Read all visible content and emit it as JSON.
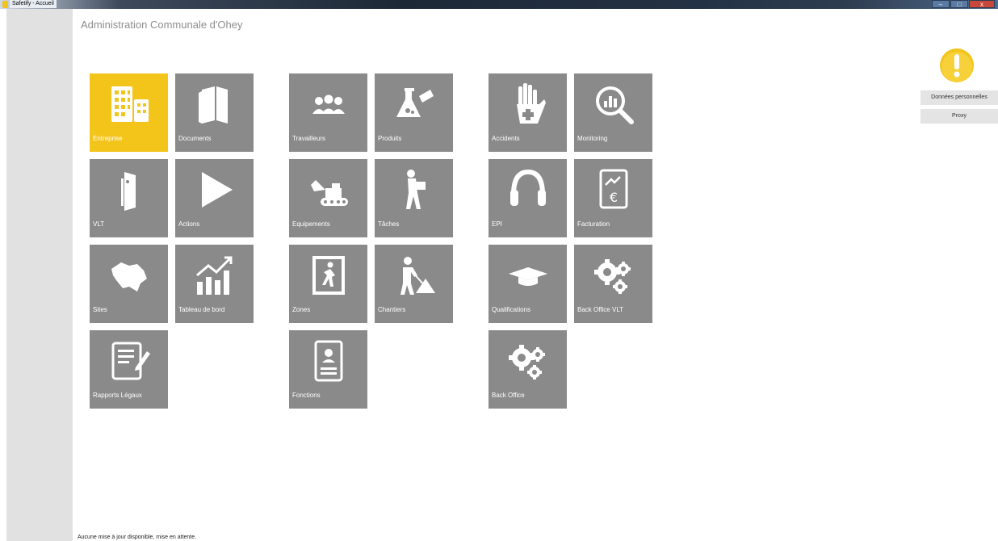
{
  "window": {
    "title": "Safetify - Accueil",
    "controls": {
      "minimize": "–",
      "maximize": "□",
      "close": "x"
    }
  },
  "page_title": "Administration Communale d'Ohey",
  "tiles": [
    {
      "label": "Entreprise",
      "icon": "building-icon",
      "active": true
    },
    {
      "label": "Documents",
      "icon": "books-icon"
    },
    {
      "label": "Travailleurs",
      "icon": "workers-icon"
    },
    {
      "label": "Produits",
      "icon": "chemical-flask-icon"
    },
    {
      "label": "Accidents",
      "icon": "hand-injury-icon"
    },
    {
      "label": "Monitoring",
      "icon": "magnifier-chart-icon"
    },
    {
      "label": "VLT",
      "icon": "door-person-icon"
    },
    {
      "label": "Actions",
      "icon": "play-icon"
    },
    {
      "label": "Equipements",
      "icon": "excavator-icon"
    },
    {
      "label": "Tâches",
      "icon": "worker-carrying-icon"
    },
    {
      "label": "EPI",
      "icon": "ear-protection-icon"
    },
    {
      "label": "Facturation",
      "icon": "invoice-euro-icon"
    },
    {
      "label": "Sites",
      "icon": "belgium-map-icon"
    },
    {
      "label": "Tableau de bord",
      "icon": "growth-chart-icon"
    },
    {
      "label": "Zones",
      "icon": "emergency-exit-icon"
    },
    {
      "label": "Chantiers",
      "icon": "construction-worker-icon"
    },
    {
      "label": "Qualifications",
      "icon": "graduation-cap-icon"
    },
    {
      "label": "Back Office VLT",
      "icon": "gears-icon"
    },
    {
      "label": "Rapports Légaux",
      "icon": "report-edit-icon"
    },
    {
      "label": "Fonctions",
      "icon": "id-card-icon"
    },
    {
      "label": "Back Office",
      "icon": "gears-icon"
    }
  ],
  "side_panel": {
    "personal_data_button": "Données personnelles",
    "proxy_button": "Proxy"
  },
  "status_text": "Aucune mise à jour disponible, mise en attente.",
  "colors": {
    "tile": "#8a8a8a",
    "tile_active": "#f3c51b",
    "alert": "#f3c51b"
  }
}
